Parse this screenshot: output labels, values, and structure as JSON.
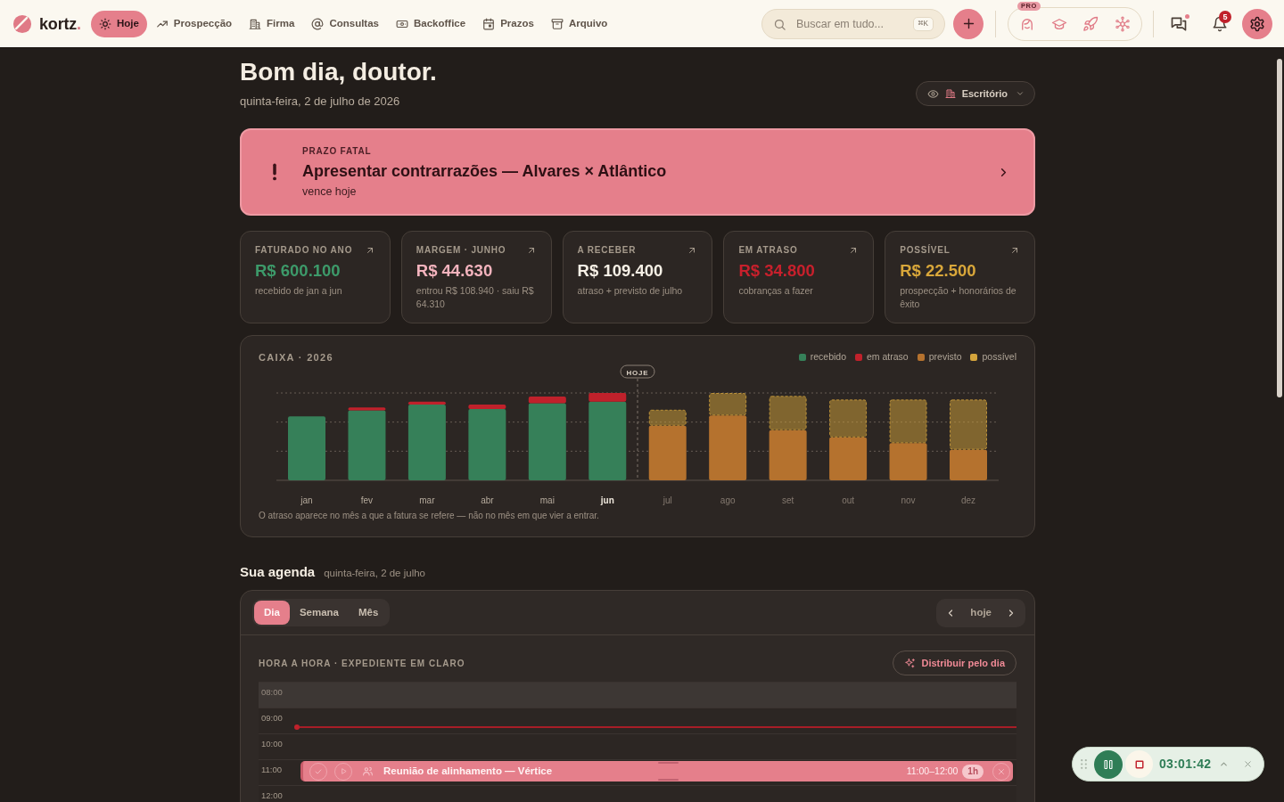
{
  "header": {
    "logo": {
      "text": "kortz",
      "dot": "."
    },
    "nav": [
      {
        "label": "Hoje",
        "selected": true
      },
      {
        "label": "Prospecção",
        "selected": false
      },
      {
        "label": "Firma",
        "selected": false
      },
      {
        "label": "Consultas",
        "selected": false
      },
      {
        "label": "Backoffice",
        "selected": false
      },
      {
        "label": "Prazos",
        "selected": false
      },
      {
        "label": "Arquivo",
        "selected": false
      }
    ],
    "search": {
      "placeholder": "Buscar em tudo...",
      "shortcut": "⌘K"
    },
    "pro_badge": "PRO",
    "messages": {
      "unread": true
    },
    "notifications": {
      "count": "5"
    }
  },
  "greeting": {
    "title": "Bom dia, doutor.",
    "date": "quinta-feira, 2 de julho de 2026",
    "view_selector": "Escritório"
  },
  "alert": {
    "label": "PRAZO FATAL",
    "title": "Apresentar contrarrazões — Alvares × Atlântico",
    "due": "vence hoje"
  },
  "kpis": [
    {
      "label": "FATURADO NO ANO",
      "value": "R$ 600.100",
      "note": "recebido de jan a jun",
      "color": "#3d9a6a"
    },
    {
      "label": "MARGEM · JUNHO",
      "value": "R$ 44.630",
      "note": "entrou R$ 108.940 · saiu R$ 64.310",
      "color": "#f3b3bd"
    },
    {
      "label": "A RECEBER",
      "value": "R$ 109.400",
      "note": "atraso + previsto de julho",
      "color": "#f6f0e6"
    },
    {
      "label": "EM ATRASO",
      "value": "R$ 34.800",
      "note": "cobranças a fazer",
      "color": "#c8202c"
    },
    {
      "label": "POSSÍVEL",
      "value": "R$ 22.500",
      "note": "prospecção + honorários de êxito",
      "color": "#d9a73a"
    }
  ],
  "cash_flow": {
    "title": "CAIXA · 2026",
    "legend": [
      {
        "label": "recebido",
        "color": "#368059"
      },
      {
        "label": "em atraso",
        "color": "#c0212b"
      },
      {
        "label": "previsto",
        "color": "#b5722e"
      },
      {
        "label": "possível",
        "color": "#d4a43c"
      }
    ],
    "today_marker": "HOJE",
    "months": [
      {
        "label": "jan",
        "current": false
      },
      {
        "label": "fev",
        "current": false
      },
      {
        "label": "mar",
        "current": false
      },
      {
        "label": "abr",
        "current": false
      },
      {
        "label": "mai",
        "current": false
      },
      {
        "label": "jun",
        "current": true
      },
      {
        "label": "jul",
        "current": false
      },
      {
        "label": "ago",
        "current": false
      },
      {
        "label": "set",
        "current": false
      },
      {
        "label": "out",
        "current": false
      },
      {
        "label": "nov",
        "current": false
      },
      {
        "label": "dez",
        "current": false
      }
    ],
    "note": "O atraso aparece no mês a que a fatura se refere — não no mês em que vier a entrar."
  },
  "agenda": {
    "title": "Sua agenda",
    "date": "quinta-feira, 2 de julho",
    "views": [
      {
        "label": "Dia",
        "selected": true
      },
      {
        "label": "Semana",
        "selected": false
      },
      {
        "label": "Mês",
        "selected": false
      }
    ],
    "today_button": "hoje",
    "section_label": "HORA A HORA · EXPEDIENTE EM CLARO",
    "distribute_button": "Distribuir pelo dia",
    "hours": [
      {
        "time": "08:00",
        "off_hours": true
      },
      {
        "time": "09:00",
        "off_hours": false,
        "now_line": true
      },
      {
        "time": "10:00",
        "off_hours": false
      },
      {
        "time": "11:00",
        "off_hours": false,
        "events": [
          {
            "title": "Reunião de alinhamento — Vértice",
            "time": "11:00–12:00",
            "duration": "1h"
          }
        ]
      },
      {
        "time": "12:00",
        "off_hours": false
      }
    ]
  },
  "timer": {
    "time": "03:01:42",
    "running": true
  }
}
